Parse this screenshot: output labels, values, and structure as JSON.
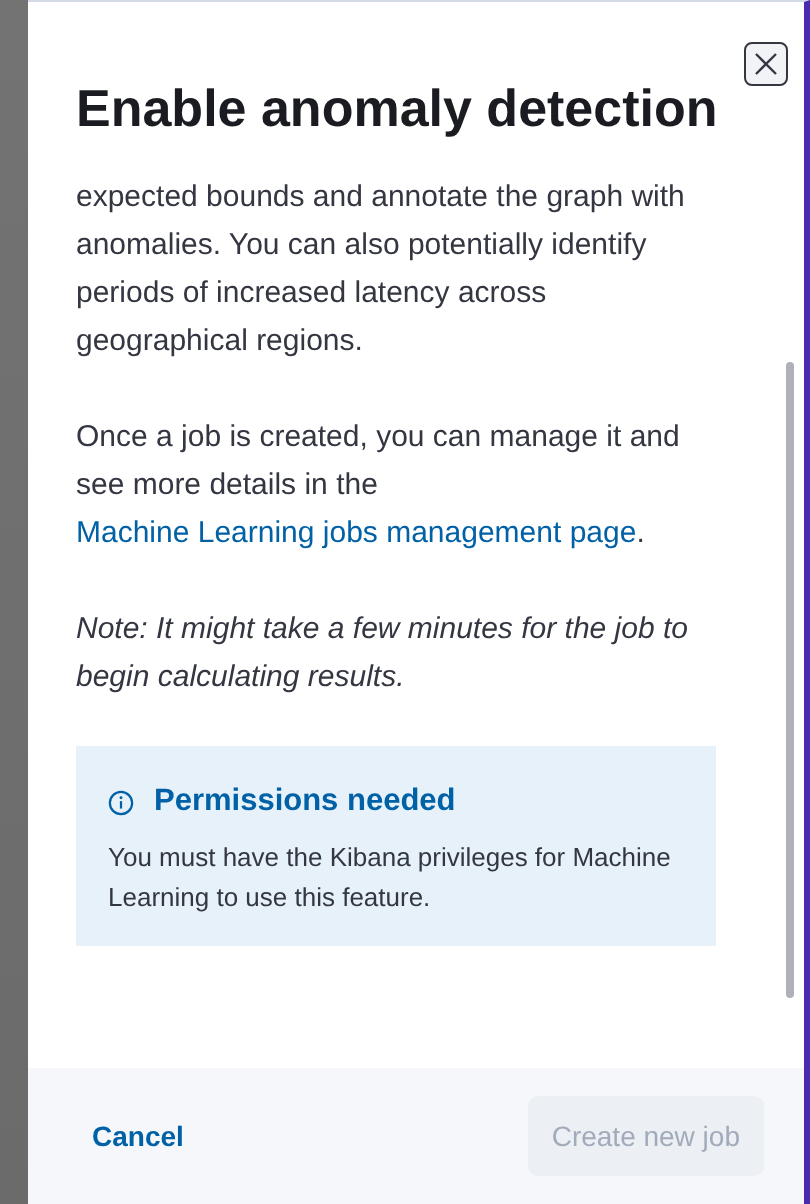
{
  "flyout": {
    "title": "Enable anomaly detection",
    "paragraphs": [
      {
        "kind": "plain",
        "text": "expected bounds and annotate the graph with anomalies. You can also potentially identify periods of increased latency across geographical regions."
      },
      {
        "kind": "link",
        "text": "Once a job is created, you can manage it and see more details in the ",
        "link": "Machine Learning jobs management page",
        "after": "."
      },
      {
        "kind": "italic",
        "text": "Note: It might take a few minutes for the job to begin calculating results."
      }
    ],
    "callout": {
      "title": "Permissions needed",
      "text": "You must have the Kibana privileges for Machine Learning to use this feature."
    },
    "footer": {
      "cancel": "Cancel",
      "create": {
        "label": "Create new job",
        "disabled": true
      }
    }
  }
}
